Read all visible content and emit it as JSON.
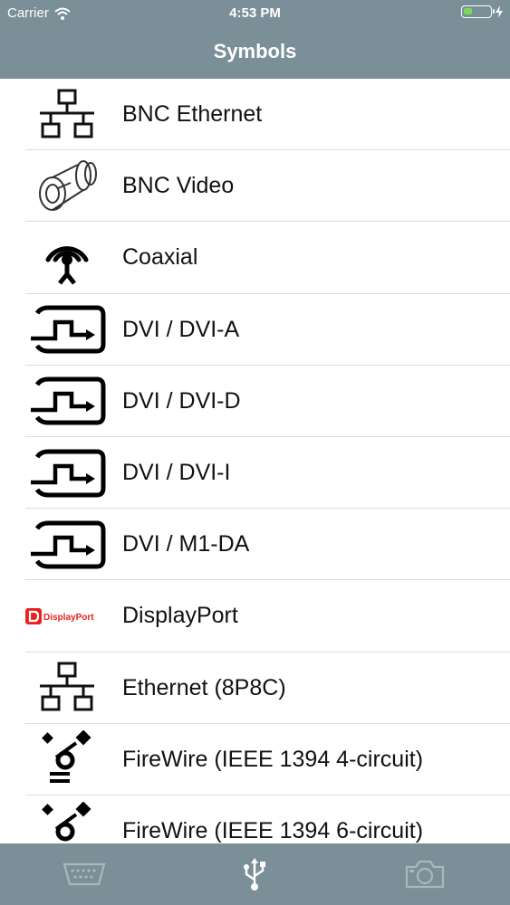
{
  "status_bar": {
    "carrier": "Carrier",
    "time": "4:53 PM",
    "battery_level": 0.35
  },
  "nav": {
    "title": "Symbols"
  },
  "items": [
    {
      "label": "BNC Ethernet",
      "icon": "network-icon"
    },
    {
      "label": "BNC Video",
      "icon": "bnc-connector-icon"
    },
    {
      "label": "Coaxial",
      "icon": "antenna-icon"
    },
    {
      "label": "DVI / DVI-A",
      "icon": "dvi-icon"
    },
    {
      "label": "DVI / DVI-D",
      "icon": "dvi-icon"
    },
    {
      "label": "DVI / DVI-I",
      "icon": "dvi-icon"
    },
    {
      "label": "DVI / M1-DA",
      "icon": "dvi-icon"
    },
    {
      "label": "DisplayPort",
      "icon": "displayport-logo",
      "logo_text": "DisplayPort"
    },
    {
      "label": "Ethernet (8P8C)",
      "icon": "network-icon"
    },
    {
      "label": "FireWire (IEEE 1394 4-circuit)",
      "icon": "firewire-icon"
    },
    {
      "label": "FireWire (IEEE 1394 6-circuit)",
      "icon": "firewire-icon"
    }
  ],
  "tabs": [
    {
      "icon": "serial-port-icon",
      "active": false
    },
    {
      "icon": "usb-icon",
      "active": true
    },
    {
      "icon": "camera-icon",
      "active": false
    }
  ],
  "colors": {
    "bar": "#7b8f98",
    "battery": "#7ed957",
    "displayport_red": "#e8231e"
  }
}
